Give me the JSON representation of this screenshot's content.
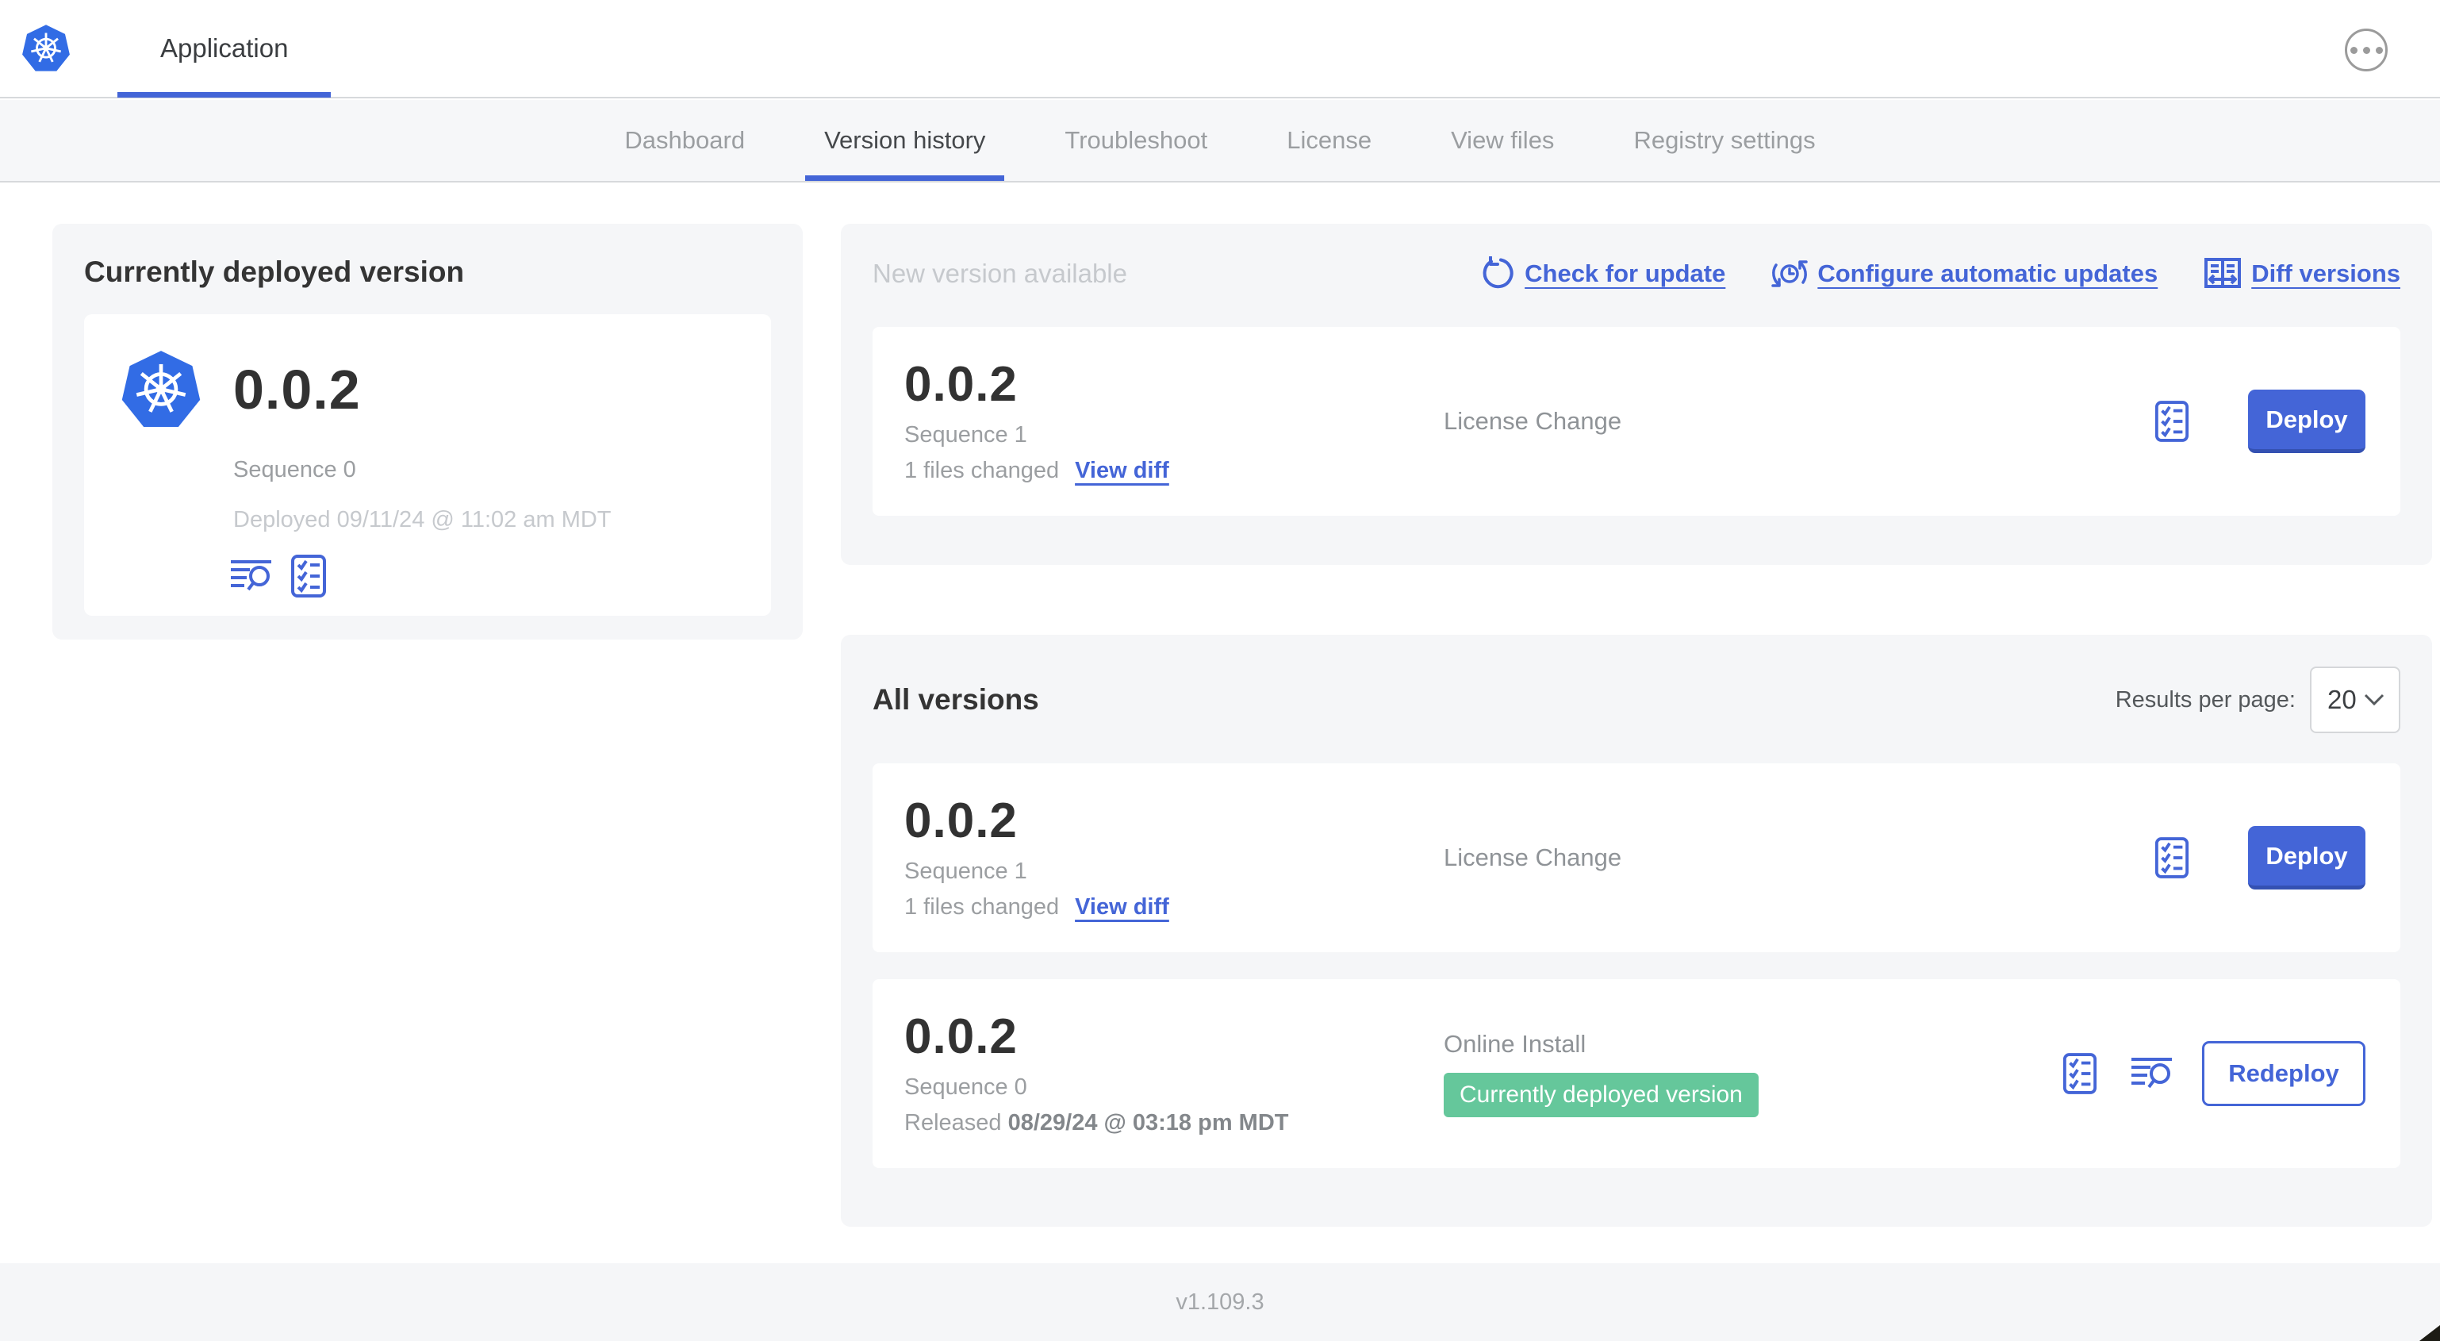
{
  "colors": {
    "accent_blue": "#4465d7",
    "logo_blue": "#326ce5",
    "badge_green": "#65c79b",
    "panel_gray": "#f5f6f8"
  },
  "header": {
    "app_tab_label": "Application"
  },
  "nav_tabs": [
    {
      "label": "Dashboard",
      "active": false
    },
    {
      "label": "Version history",
      "active": true
    },
    {
      "label": "Troubleshoot",
      "active": false
    },
    {
      "label": "License",
      "active": false
    },
    {
      "label": "View files",
      "active": false
    },
    {
      "label": "Registry settings",
      "active": false
    }
  ],
  "current_version_card": {
    "title": "Currently deployed version",
    "version": "0.0.2",
    "sequence": "Sequence 0",
    "deployed": "Deployed 09/11/24 @ 11:02 am MDT"
  },
  "new_version_panel": {
    "title": "New version available",
    "check_for_update": "Check for update",
    "configure_automatic_updates": "Configure automatic updates",
    "diff_versions": "Diff versions",
    "row": {
      "version": "0.0.2",
      "sequence": "Sequence 1",
      "files_changed": "1 files changed",
      "view_diff": "View diff",
      "source": "License Change",
      "action_label": "Deploy"
    }
  },
  "all_versions_panel": {
    "title": "All versions",
    "results_per_page_label": "Results per page:",
    "results_per_page_value": "20",
    "rows": [
      {
        "version": "0.0.2",
        "sequence": "Sequence 1",
        "files_changed": "1 files changed",
        "view_diff": "View diff",
        "source": "License Change",
        "action_label": "Deploy"
      },
      {
        "version": "0.0.2",
        "sequence": "Sequence 0",
        "released_prefix": "Released",
        "released_date": "08/29/24 @ 03:18 pm MDT",
        "source": "Online Install",
        "badge": "Currently deployed version",
        "action_label": "Redeploy"
      }
    ]
  },
  "footer": {
    "version": "v1.109.3"
  }
}
